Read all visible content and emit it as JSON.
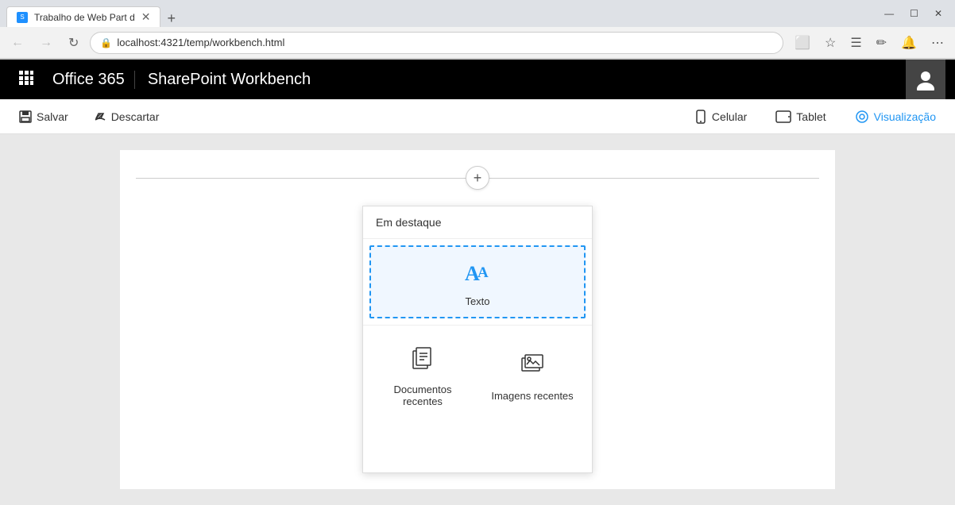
{
  "browser": {
    "tab_title": "Trabalho de Web Part d",
    "tab_favicon": "S",
    "new_tab_label": "+",
    "address": "localhost:4321/temp/workbench.html",
    "lock_icon": "🔒",
    "win_minimize": "—",
    "win_maximize": "☐",
    "win_close": "✕",
    "nav_back": "←",
    "nav_forward": "→",
    "nav_refresh": "↻"
  },
  "appbar": {
    "waffle_icon": "⊞",
    "office365": "Office 365",
    "title": "SharePoint Workbench",
    "user_icon": "👤"
  },
  "toolbar": {
    "save_label": "Salvar",
    "discard_label": "Descartar",
    "mobile_label": "Celular",
    "tablet_label": "Tablet",
    "preview_label": "Visualização"
  },
  "picker": {
    "header": "Em destaque",
    "featured_item": {
      "icon": "AA",
      "label": "Texto"
    },
    "items": [
      {
        "icon": "docs",
        "label": "Documentos recentes"
      },
      {
        "icon": "images",
        "label": "Imagens recentes"
      }
    ]
  },
  "add_button_title": "+"
}
